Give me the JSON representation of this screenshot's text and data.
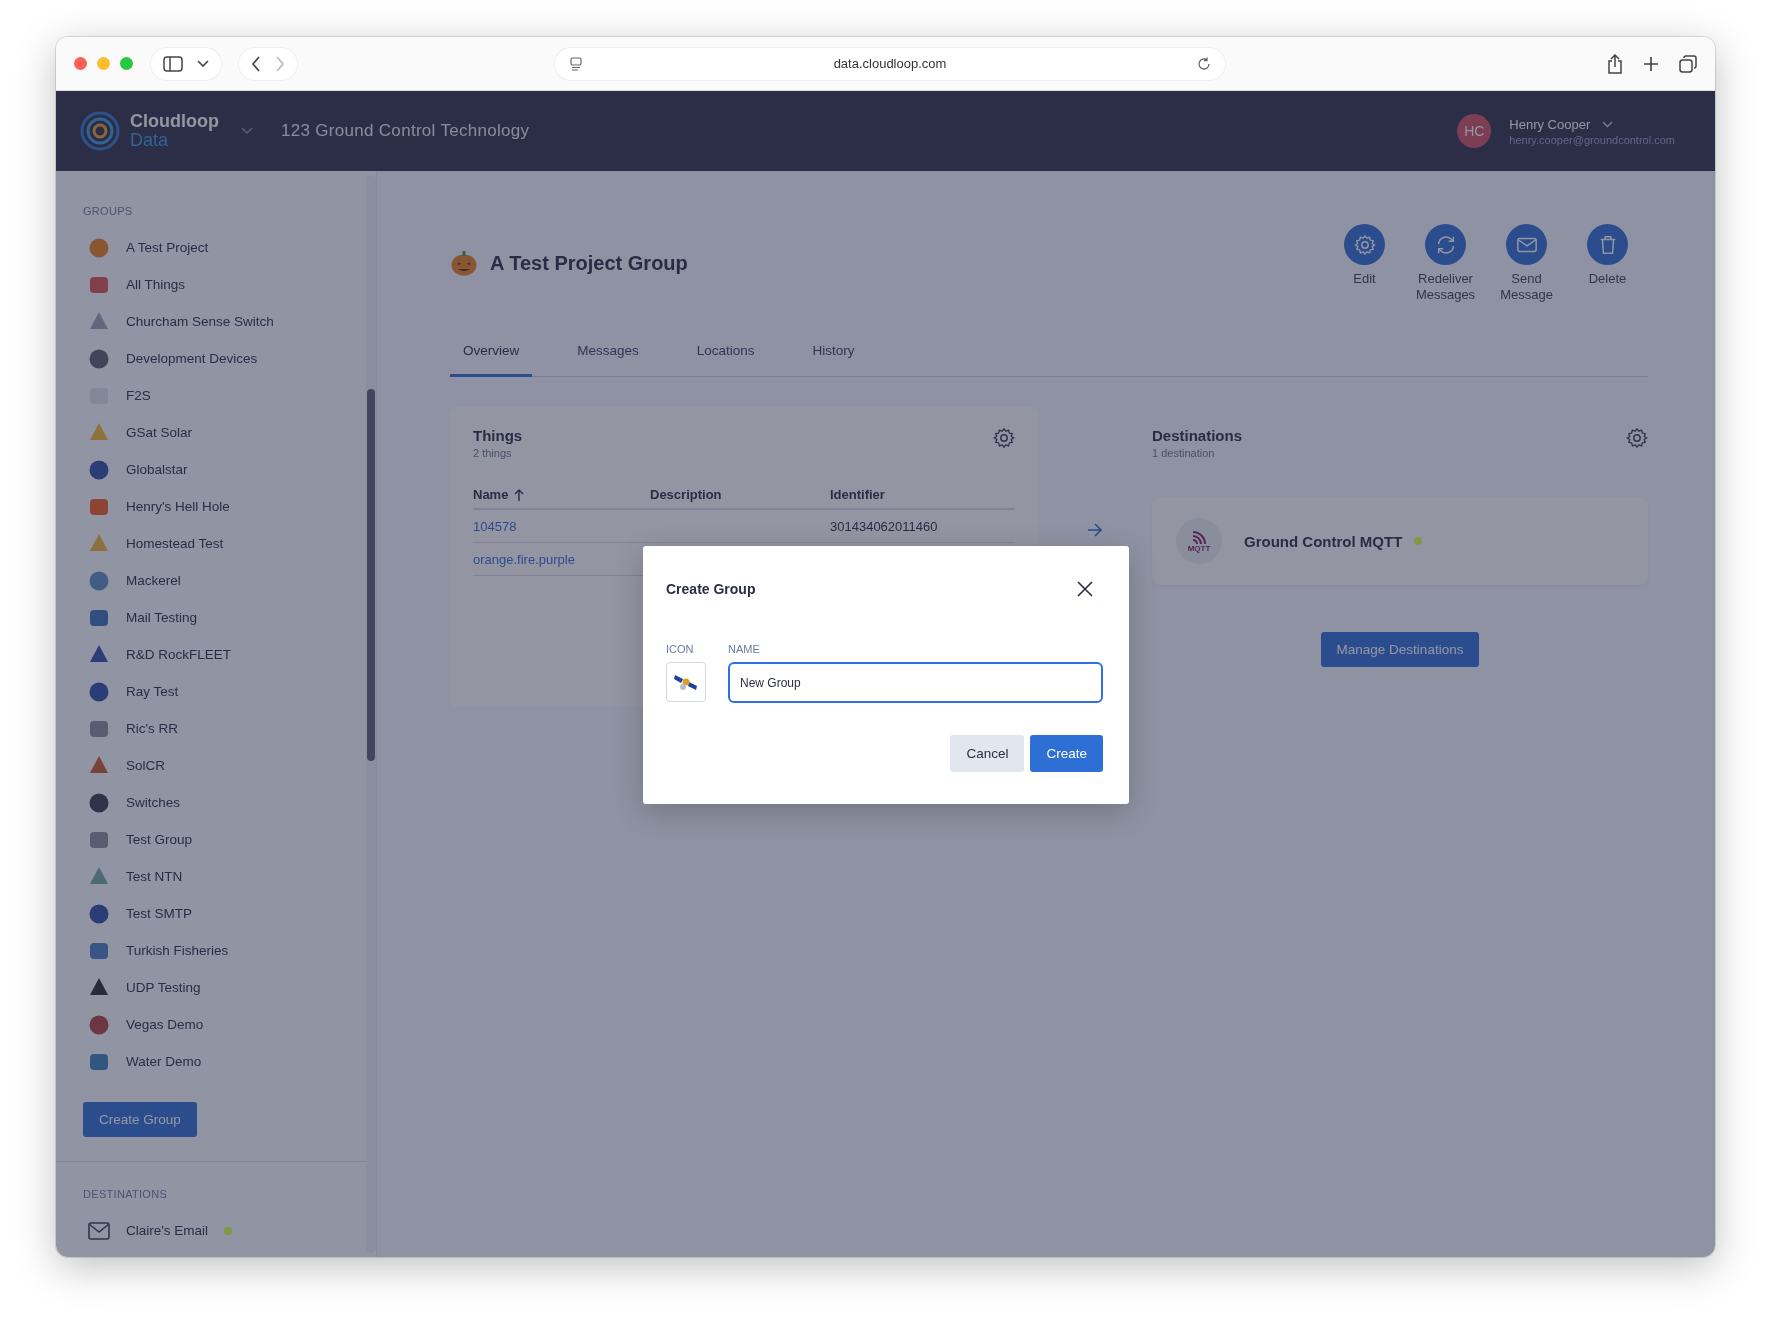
{
  "browser": {
    "url": "data.cloudloop.com"
  },
  "header": {
    "brand_line1": "Cloudloop",
    "brand_line2": "Data",
    "org": "123 Ground Control Technology",
    "user": {
      "initials": "HC",
      "name": "Henry Cooper",
      "email": "henry.cooper@groundcontrol.com"
    }
  },
  "sidebar": {
    "groups_heading": "GROUPS",
    "groups": [
      {
        "label": "A Test Project"
      },
      {
        "label": "All Things"
      },
      {
        "label": "Churcham Sense Switch"
      },
      {
        "label": "Development Devices"
      },
      {
        "label": "F2S"
      },
      {
        "label": "GSat Solar"
      },
      {
        "label": "Globalstar"
      },
      {
        "label": "Henry's Hell Hole"
      },
      {
        "label": "Homestead Test"
      },
      {
        "label": "Mackerel"
      },
      {
        "label": "Mail Testing"
      },
      {
        "label": "R&D RockFLEET"
      },
      {
        "label": "Ray Test"
      },
      {
        "label": "Ric's RR"
      },
      {
        "label": "SolCR"
      },
      {
        "label": "Switches"
      },
      {
        "label": "Test Group"
      },
      {
        "label": "Test NTN"
      },
      {
        "label": "Test SMTP"
      },
      {
        "label": "Turkish Fisheries"
      },
      {
        "label": "UDP Testing"
      },
      {
        "label": "Vegas Demo"
      },
      {
        "label": "Water Demo"
      }
    ],
    "create_button": "Create Group",
    "destinations_heading": "DESTINATIONS",
    "destinations": [
      {
        "label": "Claire's Email",
        "color": "#7f9a45"
      }
    ]
  },
  "page": {
    "title": "A Test Project Group",
    "actions": [
      {
        "label": "Edit",
        "kind": "gear"
      },
      {
        "label": "Redeliver Messages",
        "kind": "refresh"
      },
      {
        "label": "Send Message",
        "kind": "mail"
      },
      {
        "label": "Delete",
        "kind": "trash"
      }
    ],
    "tabs": [
      {
        "label": "Overview",
        "selected": true
      },
      {
        "label": "Messages",
        "selected": false
      },
      {
        "label": "Locations",
        "selected": false
      },
      {
        "label": "History",
        "selected": false
      }
    ],
    "things": {
      "title": "Things",
      "count": "2 things",
      "columns": [
        "Name",
        "Description",
        "Identifier"
      ],
      "rows": [
        {
          "name": "104578",
          "identifier": "301434062011460"
        },
        {
          "name": "orange.fire.purple"
        }
      ]
    },
    "destinations": {
      "title": "Destinations",
      "count": "1 destination",
      "items": [
        {
          "name": "Ground Control MQTT",
          "logo_text": "MQTT",
          "color": "#7f9a45"
        }
      ],
      "manage_button": "Manage Destinations"
    }
  },
  "dialog": {
    "title": "Create Group",
    "icon_label": "ICON",
    "name_label": "NAME",
    "name_value": "New Group",
    "buttons": [
      {
        "label": "Cancel",
        "kind": "secondary"
      },
      {
        "label": "Create",
        "kind": "primary"
      }
    ]
  }
}
